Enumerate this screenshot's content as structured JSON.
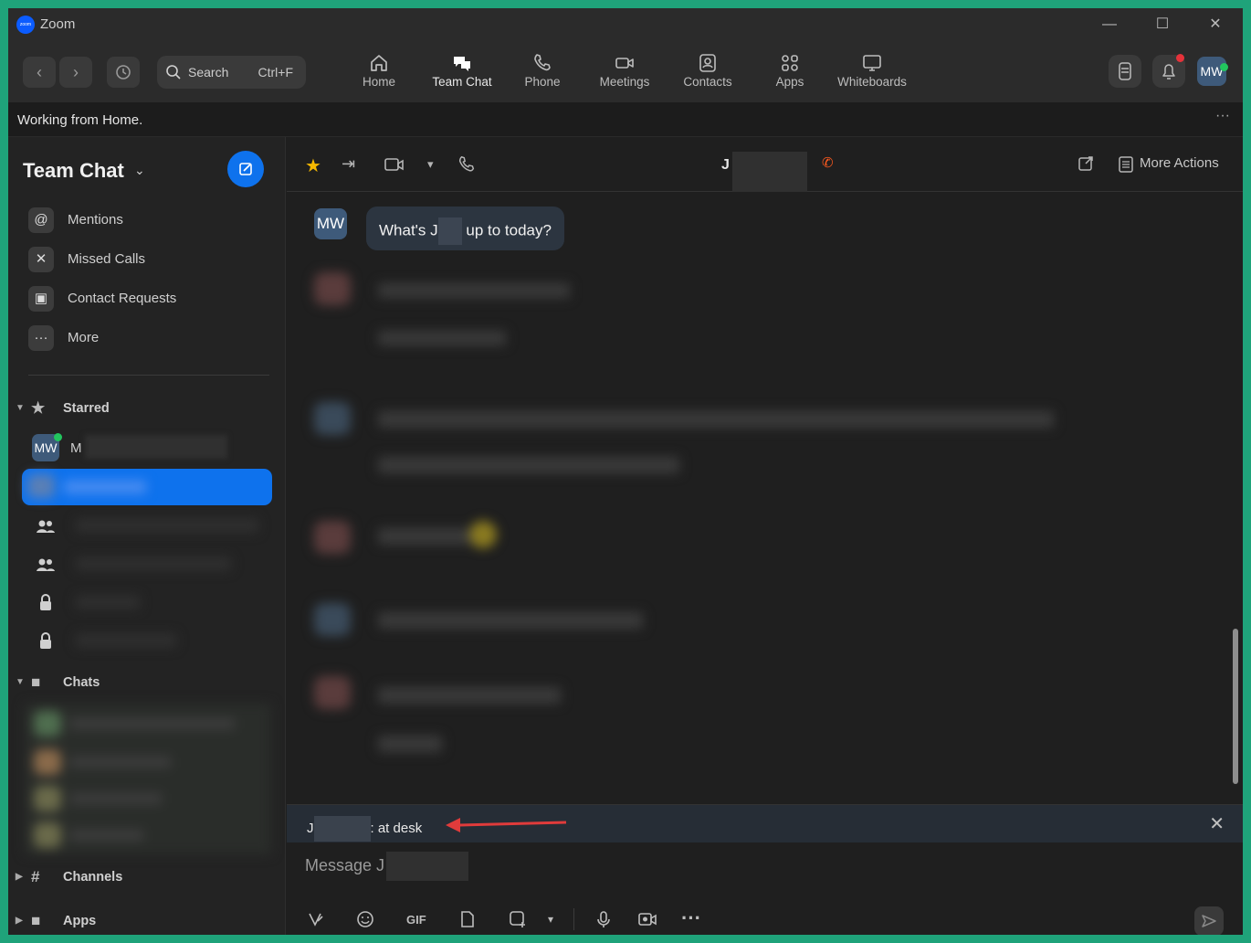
{
  "window": {
    "app_title": "Zoom",
    "minimize": "—",
    "maximize": "☐",
    "close": "✕"
  },
  "toolbar": {
    "search_label": "Search",
    "search_shortcut": "Ctrl+F",
    "tabs": [
      {
        "label": "Home",
        "icon": "home-icon"
      },
      {
        "label": "Team Chat",
        "icon": "chat-icon",
        "active": true
      },
      {
        "label": "Phone",
        "icon": "phone-icon"
      },
      {
        "label": "Meetings",
        "icon": "video-icon"
      },
      {
        "label": "Contacts",
        "icon": "contacts-icon"
      },
      {
        "label": "Apps",
        "icon": "apps-icon"
      },
      {
        "label": "Whiteboards",
        "icon": "whiteboard-icon"
      }
    ],
    "avatar_initials": "MW"
  },
  "status_banner": {
    "text": "Working from Home.",
    "more": "···"
  },
  "sidebar": {
    "title": "Team Chat",
    "items": [
      {
        "label": "Mentions",
        "icon": "at-icon"
      },
      {
        "label": "Missed Calls",
        "icon": "missed-call-icon"
      },
      {
        "label": "Contact Requests",
        "icon": "contact-request-icon"
      },
      {
        "label": "More",
        "icon": "more-icon"
      }
    ],
    "sections": {
      "starred": "Starred",
      "chats": "Chats",
      "channels": "Channels",
      "apps": "Apps"
    },
    "starred_contact": {
      "initials": "MW",
      "name": "M"
    }
  },
  "chat": {
    "header_name": "J",
    "more_actions": "More Actions",
    "message_avatar": "MW",
    "message_prefix": "What's J",
    "message_suffix": " up to today?",
    "status_prefix": "J",
    "status_suffix": ": at desk",
    "placeholder": "Message J",
    "gif_label": "GIF"
  },
  "colors": {
    "accent": "#0e72ed",
    "background": "#1f1f1f",
    "frame": "#1fa37a",
    "annotation_arrow": "#e03b3b"
  }
}
